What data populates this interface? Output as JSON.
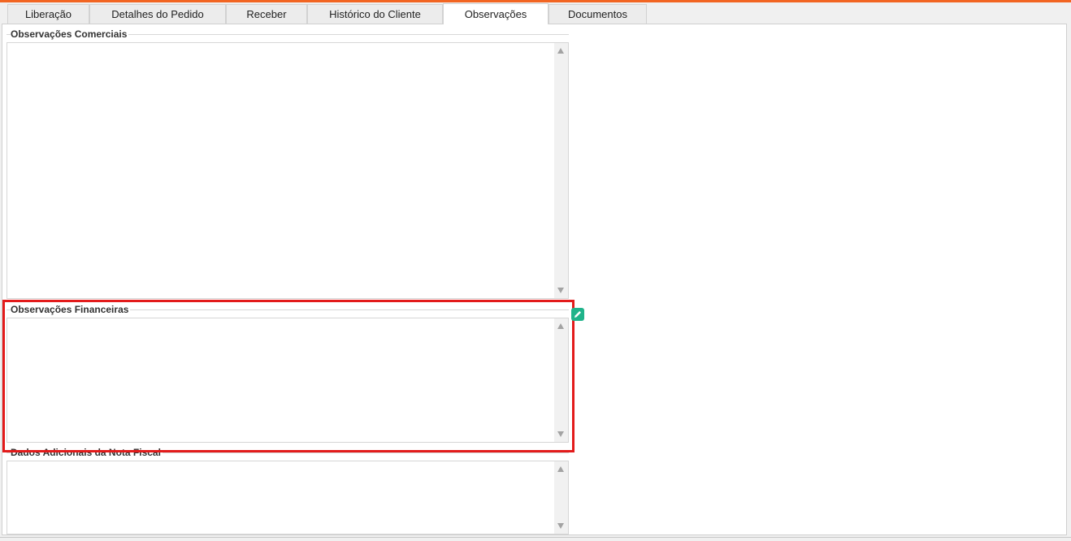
{
  "tabs": [
    {
      "label": "Liberação",
      "active": false
    },
    {
      "label": "Detalhes do Pedido",
      "active": false
    },
    {
      "label": "Receber",
      "active": false
    },
    {
      "label": "Histórico do Cliente",
      "active": false
    },
    {
      "label": "Observações",
      "active": true
    },
    {
      "label": "Documentos",
      "active": false
    }
  ],
  "sections": {
    "comerciais": {
      "title": "Observações Comerciais",
      "value": ""
    },
    "financeiras": {
      "title": "Observações Financeiras",
      "value": ""
    },
    "nota_fiscal": {
      "title": "Dados Adicionais da Nota Fiscal",
      "value": ""
    }
  },
  "colors": {
    "accent": "#f26522",
    "highlight": "#e31b1b",
    "edit_icon": "#1fb38a"
  },
  "icons": {
    "edit": "pencil-edit-icon"
  }
}
